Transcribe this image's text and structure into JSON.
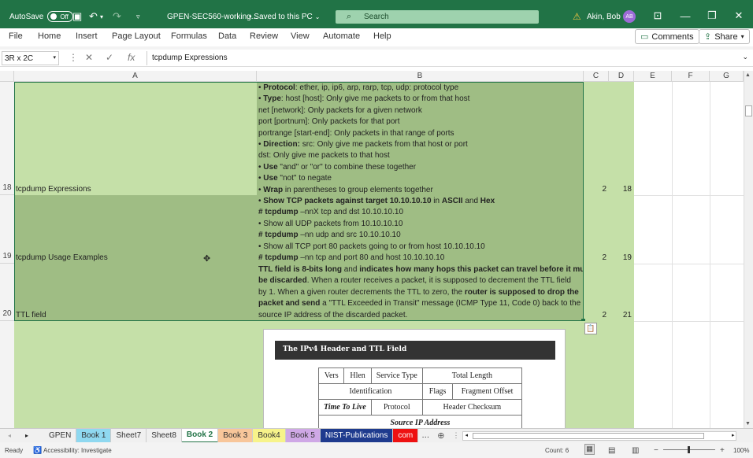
{
  "titlebar": {
    "autosave_label": "AutoSave",
    "autosave_state": "Off",
    "filename": "GPEN-SEC560-working...",
    "saved_status": "• Saved to this PC",
    "search_placeholder": "Search",
    "user_name": "Akin, Bob",
    "user_initials": "AB"
  },
  "menu": {
    "items": [
      "File",
      "Home",
      "Insert",
      "Page Layout",
      "Formulas",
      "Data",
      "Review",
      "View",
      "Automate",
      "Help"
    ],
    "comments_label": "Comments",
    "share_label": "Share"
  },
  "formula_bar": {
    "name_box": "3R x 2C",
    "fx": "fx",
    "content": "tcpdump Expressions"
  },
  "columns": [
    "A",
    "B",
    "C",
    "D",
    "E",
    "F",
    "G"
  ],
  "rows": [
    {
      "num": "18",
      "a": "tcpdump Expressions",
      "c": "2",
      "d": "18",
      "b_lines": [
        [
          {
            "t": "• "
          },
          {
            "t": "Protocol",
            "b": true
          },
          {
            "t": ": ether, ip, ip6, arp, rarp, tcp, udp: protocol type"
          }
        ],
        [
          {
            "t": "• "
          },
          {
            "t": "Type",
            "b": true
          },
          {
            "t": ": host [host]: Only give me packets to or from that host"
          }
        ],
        [
          {
            "t": "net [network]: Only packets for a given network"
          }
        ],
        [
          {
            "t": "port [portnum]: Only packets for that port"
          }
        ],
        [
          {
            "t": "portrange [start-end]: Only packets in that range of ports"
          }
        ],
        [
          {
            "t": "• "
          },
          {
            "t": "Direction:",
            "b": true
          },
          {
            "t": " src: Only give me packets from that host or port"
          }
        ],
        [
          {
            "t": "dst: Only give me packets to that host"
          }
        ],
        [
          {
            "t": "• "
          },
          {
            "t": "Use",
            "b": true
          },
          {
            "t": " \"and\" or \"or\" to combine these together"
          }
        ],
        [
          {
            "t": "• "
          },
          {
            "t": "Use",
            "b": true
          },
          {
            "t": " \"not\" to negate"
          }
        ],
        [
          {
            "t": "• "
          },
          {
            "t": "Wrap",
            "b": true
          },
          {
            "t": " in parentheses to group elements together"
          }
        ]
      ]
    },
    {
      "num": "19",
      "a": "tcpdump Usage Examples",
      "c": "2",
      "d": "19",
      "b_lines": [
        [
          {
            "t": "• "
          },
          {
            "t": "Show TCP packets against target 10.10.10.10",
            "b": true
          },
          {
            "t": " in "
          },
          {
            "t": "ASCII",
            "b": true
          },
          {
            "t": " and "
          },
          {
            "t": "Hex",
            "b": true
          }
        ],
        [
          {
            "t": "# tcpdump",
            "b": true
          },
          {
            "t": " –nnX tcp and dst 10.10.10.10"
          }
        ],
        [
          {
            "t": "• Show all UDP packets from 10.10.10.10"
          }
        ],
        [
          {
            "t": "# tcpdump",
            "b": true
          },
          {
            "t": " –nn udp and src 10.10.10.10"
          }
        ],
        [
          {
            "t": "• Show all TCP port 80 packets going to or from host 10.10.10.10"
          }
        ],
        [
          {
            "t": "# tcpdump",
            "b": true
          },
          {
            "t": " –nn tcp and port 80 and host 10.10.10.10"
          }
        ]
      ]
    },
    {
      "num": "20",
      "a": "TTL field",
      "c": "2",
      "d": "21",
      "b_lines": [
        [
          {
            "t": "TTL field is 8-bits long",
            "b": true
          },
          {
            "t": " and "
          },
          {
            "t": "indicates how many hops this packet can travel before it must",
            "b": true
          }
        ],
        [
          {
            "t": "be discarded",
            "b": true
          },
          {
            "t": ". When a router receives a packet, it is supposed to decrement the TTL field"
          }
        ],
        [
          {
            "t": "by 1. When a given router decrements the TTL to zero, the "
          },
          {
            "t": "router is supposed to drop the",
            "b": true
          }
        ],
        [
          {
            "t": "packet and send",
            "b": true
          },
          {
            "t": " a \"TTL Exceeded in Transit\" message (ICMP Type 11, Code 0) back to the"
          }
        ],
        [
          {
            "t": "source IP address of the discarded packet."
          }
        ]
      ]
    }
  ],
  "figure": {
    "title": "The IPv4 Header and TTL Field",
    "rows": [
      [
        "Vers",
        "Hlen",
        "Service Type",
        "Total Length"
      ],
      [
        "Identification",
        "Flags",
        "Fragment Offset"
      ],
      [
        "Time To Live",
        "Protocol",
        "Header Checksum"
      ],
      [
        "Source IP Address"
      ]
    ]
  },
  "sheet_tabs": [
    {
      "label": "GPEN",
      "color": "#f0f0f0"
    },
    {
      "label": "Book 1",
      "color": "#8fd8f0"
    },
    {
      "label": "Sheet7",
      "color": "#f0f0f0"
    },
    {
      "label": "Sheet8",
      "color": "#f0f0f0"
    },
    {
      "label": "Book 2",
      "color": "#ffffff",
      "active": true
    },
    {
      "label": "Book 3",
      "color": "#f8c69a"
    },
    {
      "label": "Book4",
      "color": "#f7f38a"
    },
    {
      "label": "Book 5",
      "color": "#cfa8e6"
    },
    {
      "label": "NIST-Publications",
      "color": "#1f3b8e",
      "textcolor": "#ffffff"
    },
    {
      "label": "com",
      "color": "#ee1111",
      "textcolor": "#ffffff"
    }
  ],
  "status": {
    "ready": "Ready",
    "accessibility": "Accessibility: Investigate",
    "count": "Count: 6",
    "zoom": "100%"
  }
}
